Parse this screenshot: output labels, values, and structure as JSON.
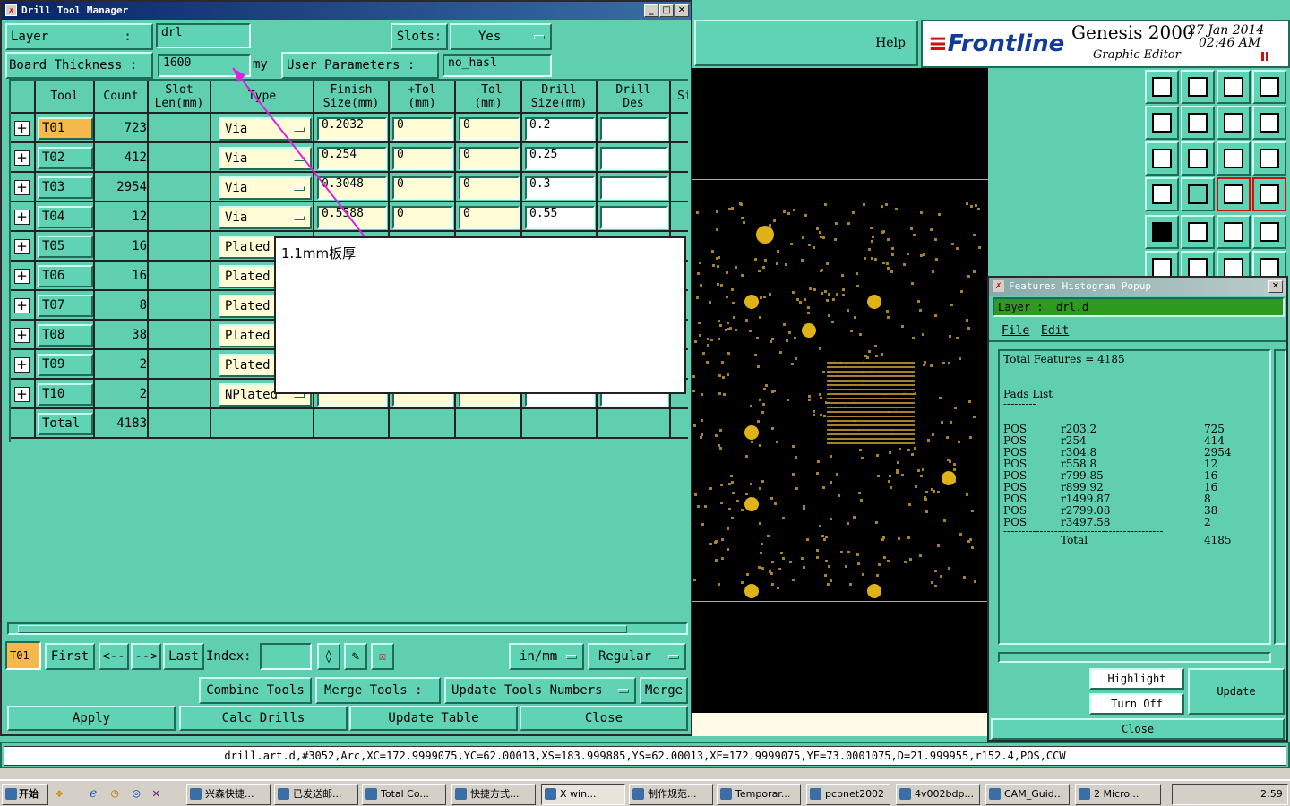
{
  "dtm": {
    "title": "Drill Tool Manager",
    "layer_label": "Layer          :",
    "layer_value": "drl",
    "slots_label": "Slots:",
    "slots_value": "Yes",
    "board_thickness_label": "Board Thickness :",
    "board_thickness_value": "1600",
    "board_unit": "my",
    "user_params_label": "User Parameters :",
    "user_params_value": "no_hasl",
    "columns": [
      "Tool",
      "Count",
      "Slot\nLen(mm)",
      "Type",
      "Finish\nSize(mm)",
      "+Tol\n(mm)",
      "-Tol\n(mm)",
      "Drill\nSize(mm)",
      "Drill\nDes",
      "Si"
    ],
    "rows": [
      {
        "tool": "T01",
        "count": "723",
        "type": "Via",
        "finish": "0.2032",
        "ptol": "0",
        "mtol": "0",
        "drill": "0.2"
      },
      {
        "tool": "T02",
        "count": "412",
        "type": "Via",
        "finish": "0.254",
        "ptol": "0",
        "mtol": "0",
        "drill": "0.25"
      },
      {
        "tool": "T03",
        "count": "2954",
        "type": "Via",
        "finish": "0.3048",
        "ptol": "0",
        "mtol": "0",
        "drill": "0.3"
      },
      {
        "tool": "T04",
        "count": "12",
        "type": "Via",
        "finish": "0.5588",
        "ptol": "0",
        "mtol": "0",
        "drill": "0.55"
      },
      {
        "tool": "T05",
        "count": "16",
        "type": "Plated",
        "finish": "",
        "ptol": "",
        "mtol": "",
        "drill": ""
      },
      {
        "tool": "T06",
        "count": "16",
        "type": "Plated",
        "finish": "",
        "ptol": "",
        "mtol": "",
        "drill": ""
      },
      {
        "tool": "T07",
        "count": "8",
        "type": "Plated",
        "finish": "",
        "ptol": "",
        "mtol": "",
        "drill": ""
      },
      {
        "tool": "T08",
        "count": "38",
        "type": "Plated",
        "finish": "",
        "ptol": "",
        "mtol": "",
        "drill": ""
      },
      {
        "tool": "T09",
        "count": "2",
        "type": "Plated",
        "finish": "",
        "ptol": "",
        "mtol": "",
        "drill": ""
      },
      {
        "tool": "T10",
        "count": "2",
        "type": "NPlated",
        "finish": "",
        "ptol": "",
        "mtol": "",
        "drill": ""
      }
    ],
    "total_label": "Total",
    "total_value": "4183",
    "current_tool": "T01",
    "nav": {
      "first": "First",
      "prev": "<--",
      "next": "-->",
      "last": "Last",
      "index": "Index:"
    },
    "units": "in/mm",
    "mode": "Regular",
    "combine": "Combine Tools",
    "merge_tools": "Merge Tools :",
    "update_numbers": "Update Tools Numbers",
    "merge": "Merge",
    "apply": "Apply",
    "calc": "Calc Drills",
    "update_table": "Update Table",
    "close": "Close"
  },
  "note": {
    "text": "1.1mm板厚"
  },
  "genesis": {
    "help": "Help",
    "brand": "Frontline",
    "product": "Genesis 2000",
    "subtitle": "Graphic Editor",
    "date": "27 Jan 2014",
    "time": "02:46 AM"
  },
  "hist": {
    "title": "Features Histogram Popup",
    "layer_label": "Layer :",
    "layer_value": "drl.d",
    "menu_file": "File",
    "menu_edit": "Edit",
    "total_features": "Total Features = 4185",
    "pads_list": "Pads List",
    "pads": [
      {
        "pol": "POS",
        "sym": "r203.2",
        "count": "725"
      },
      {
        "pol": "POS",
        "sym": "r254",
        "count": "414"
      },
      {
        "pol": "POS",
        "sym": "r304.8",
        "count": "2954"
      },
      {
        "pol": "POS",
        "sym": "r558.8",
        "count": "12"
      },
      {
        "pol": "POS",
        "sym": "r799.85",
        "count": "16"
      },
      {
        "pol": "POS",
        "sym": "r899.92",
        "count": "16"
      },
      {
        "pol": "POS",
        "sym": "r1499.87",
        "count": "8"
      },
      {
        "pol": "POS",
        "sym": "r2799.08",
        "count": "38"
      },
      {
        "pol": "POS",
        "sym": "r3497.58",
        "count": "2"
      }
    ],
    "total_label": "Total",
    "total_value": "4185",
    "highlight": "Highlight",
    "turn_off": "Turn Off",
    "update": "Update",
    "close": "Close"
  },
  "status": "drill.art.d,#3052,Arc,XC=172.9999075,YC=62.00013,XS=183.999885,YS=62.00013,XE=172.9999075,YE=73.0001075,D=21.999955,r152.4,POS,CCW",
  "taskbar": {
    "start": "开始",
    "tasks": [
      "兴森快捷...",
      "已发送邮...",
      "Total Co...",
      "快捷方式...",
      "X win...",
      "制作规范...",
      "Temporar...",
      "pcbnet2002",
      "4v002bdp...",
      "CAM_Guid...",
      "2 Micro..."
    ],
    "clock": "2:59"
  }
}
